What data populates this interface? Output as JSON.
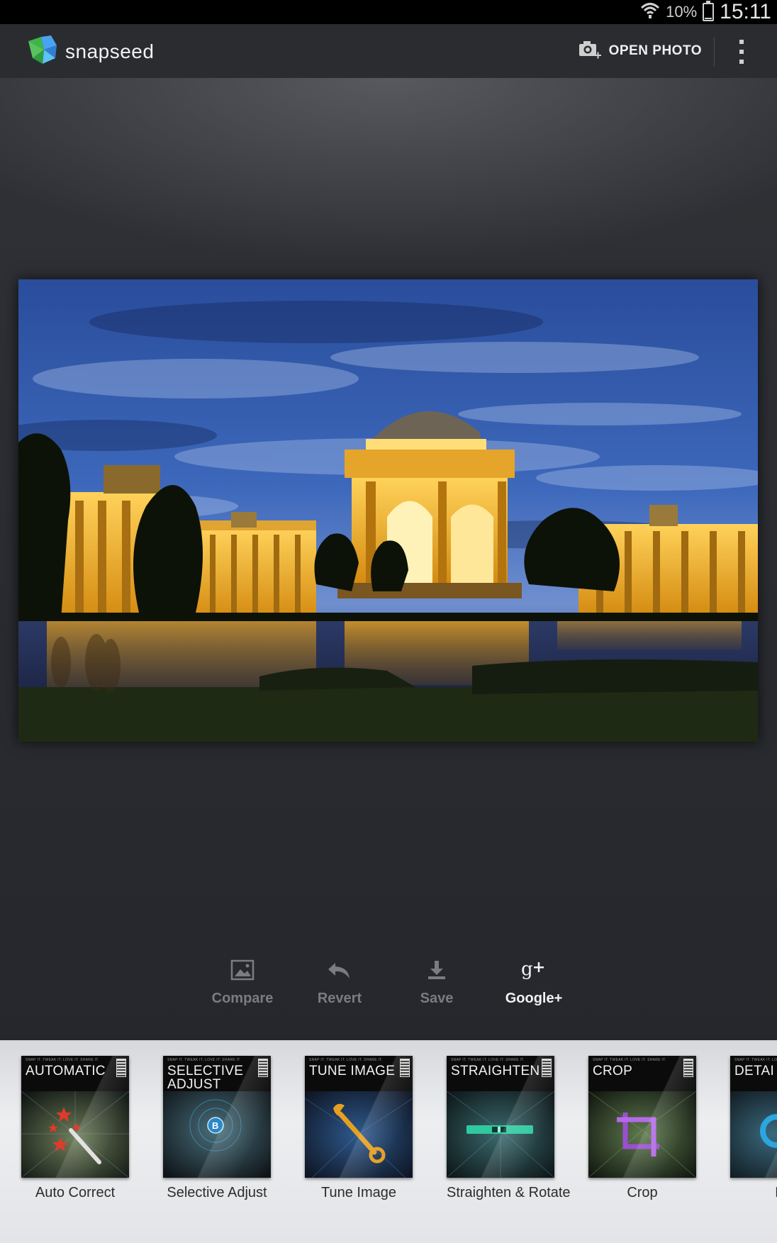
{
  "status_bar": {
    "battery_percent": "10%",
    "battery_level": 0.1,
    "clock": "15:11",
    "icons": [
      "wifi-icon",
      "battery-icon"
    ]
  },
  "action_bar": {
    "app_name": "snapseed",
    "open_photo_label": "OPEN PHOTO",
    "icons": [
      "snapseed-logo-icon",
      "camera-add-icon",
      "overflow-menu-icon"
    ]
  },
  "photo": {
    "description_icon": "photo-image"
  },
  "actions": [
    {
      "label": "Compare",
      "icon": "image-icon",
      "active": false
    },
    {
      "label": "Revert",
      "icon": "undo-arrow-icon",
      "active": false
    },
    {
      "label": "Save",
      "icon": "download-icon",
      "active": false
    },
    {
      "label": "Google+",
      "icon": "google-plus-icon",
      "active": true
    }
  ],
  "tools": [
    {
      "card_title": "AUTOMATIC",
      "label": "Auto Correct",
      "icon": "magic-wand-icon"
    },
    {
      "card_title": "SELECTIVE\nADJUST",
      "label": "Selective Adjust",
      "icon": "control-point-icon"
    },
    {
      "card_title": "TUNE IMAGE",
      "label": "Tune Image",
      "icon": "wrench-icon"
    },
    {
      "card_title": "STRAIGHTEN",
      "label": "Straighten & Rotate",
      "icon": "level-icon"
    },
    {
      "card_title": "CROP",
      "label": "Crop",
      "icon": "crop-icon"
    },
    {
      "card_title": "DETAI",
      "label": "De",
      "icon": "details-icon"
    }
  ],
  "card_fineprint": "SNAP IT. TWEAK IT. LOVE IT. SHARE IT.",
  "colors": {
    "status_bar": "#000000",
    "action_bar": "#2b2c30",
    "canvas": "#26282d",
    "strip": "#e2e4e7",
    "active_label": "#f2f2f2",
    "inactive_label": "#7a7c82",
    "logo_green": "#3db54a",
    "logo_blue": "#3e8fe0"
  }
}
